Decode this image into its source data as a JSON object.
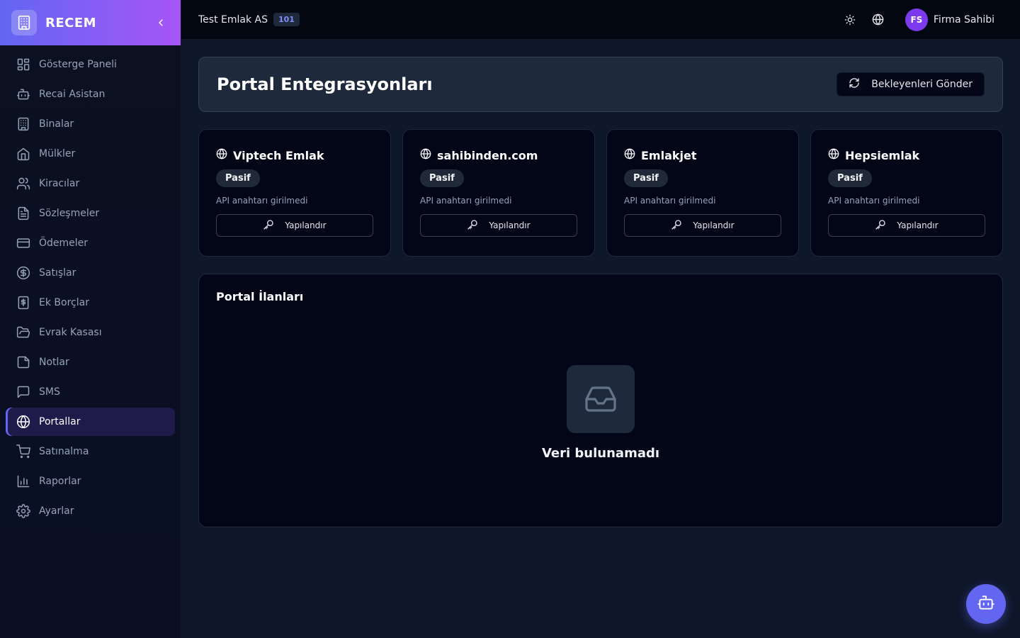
{
  "brand": {
    "name": "RECEM",
    "logo_icon": "building-icon",
    "collapse_icon": "chevron-left-icon"
  },
  "sidebar": {
    "items": [
      {
        "label": "Gösterge Paneli",
        "icon": "dashboard-grid-icon",
        "active": false
      },
      {
        "label": "Recai Asistan",
        "icon": "bot-icon",
        "active": false
      },
      {
        "label": "Binalar",
        "icon": "building-icon",
        "active": false
      },
      {
        "label": "Mülkler",
        "icon": "home-icon",
        "active": false
      },
      {
        "label": "Kiracılar",
        "icon": "users-icon",
        "active": false
      },
      {
        "label": "Sözleşmeler",
        "icon": "file-text-icon",
        "active": false
      },
      {
        "label": "Ödemeler",
        "icon": "credit-card-icon",
        "active": false
      },
      {
        "label": "Satışlar",
        "icon": "dollar-circle-icon",
        "active": false
      },
      {
        "label": "Ek Borçlar",
        "icon": "receipt-dollar-icon",
        "active": false
      },
      {
        "label": "Evrak Kasası",
        "icon": "folder-open-icon",
        "active": false
      },
      {
        "label": "Notlar",
        "icon": "sticky-note-icon",
        "active": false
      },
      {
        "label": "SMS",
        "icon": "message-square-icon",
        "active": false
      },
      {
        "label": "Portallar",
        "icon": "globe-icon",
        "active": true
      },
      {
        "label": "Satınalma",
        "icon": "shopping-cart-icon",
        "active": false
      },
      {
        "label": "Raporlar",
        "icon": "bar-chart-icon",
        "active": false
      },
      {
        "label": "Ayarlar",
        "icon": "settings-gear-icon",
        "active": false
      }
    ]
  },
  "topbar": {
    "company": "Test Emlak AS",
    "company_badge": "101",
    "theme_icon": "sun-icon",
    "language_icon": "globe-icon",
    "user": {
      "initials": "FS",
      "name": "Firma Sahibi"
    }
  },
  "header": {
    "title": "Portal Entegrasyonları",
    "send_button": "Bekleyenleri Gönder",
    "send_icon": "refresh-icon"
  },
  "portals": [
    {
      "name": "Viptech Emlak",
      "status": "Pasif",
      "note": "API anahtarı girilmedi",
      "button": "Yapılandır"
    },
    {
      "name": "sahibinden.com",
      "status": "Pasif",
      "note": "API anahtarı girilmedi",
      "button": "Yapılandır"
    },
    {
      "name": "Emlakjet",
      "status": "Pasif",
      "note": "API anahtarı girilmedi",
      "button": "Yapılandır"
    },
    {
      "name": "Hepsiemlak",
      "status": "Pasif",
      "note": "API anahtarı girilmedi",
      "button": "Yapılandır"
    }
  ],
  "listings": {
    "title": "Portal İlanları",
    "empty_text": "Veri bulunamadı",
    "empty_icon": "inbox-icon"
  },
  "fab": {
    "icon": "bot-icon"
  },
  "colors": {
    "accent": "#6366f1",
    "brand_gradient_end": "#a855f7",
    "avatar": "#7c3aed",
    "background": "#0f172a",
    "card": "#020617"
  }
}
